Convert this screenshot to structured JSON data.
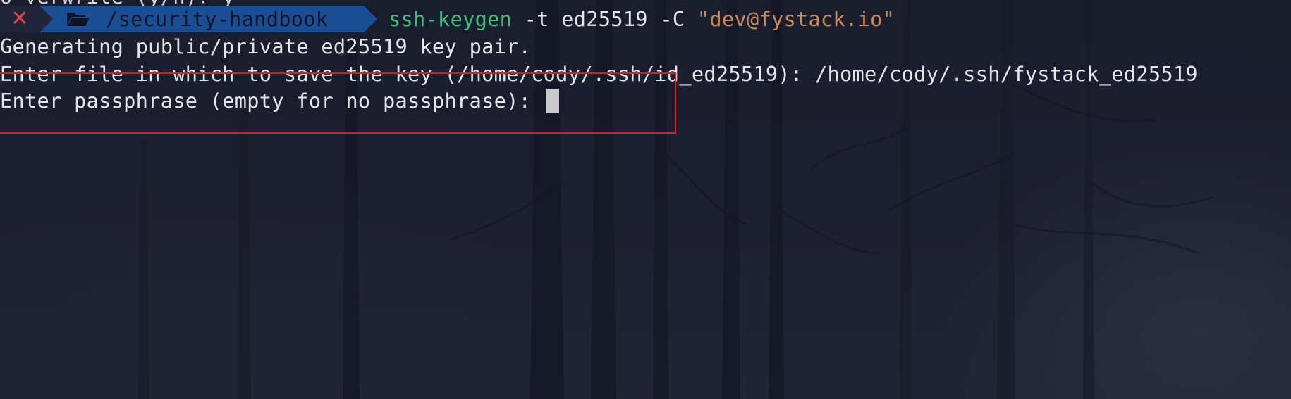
{
  "terminal": {
    "partial_top_line": "o verwrite (y/n)? y",
    "prompt": {
      "status_symbol": "✕",
      "folder_icon": "folder-open-icon",
      "path": "/security-handbook"
    },
    "command": {
      "program": "ssh-keygen",
      "args": "-t ed25519 -C",
      "comment": "\"dev@fystack.io\""
    },
    "output": {
      "generating": "Generating public/private ed25519 key pair.",
      "file_prompt": "Enter file in which to save the key (/home/cody/.ssh/id_ed25519): /home/cody/.ssh/fystack_ed25519",
      "passphrase_prompt": "Enter passphrase (empty for no passphrase): "
    },
    "colors": {
      "status_fg": "#e0434a",
      "path_bg": "#1a4e94",
      "program": "#3fbf7f",
      "string": "#c98a5c",
      "highlight_box": "#d11f26"
    }
  }
}
